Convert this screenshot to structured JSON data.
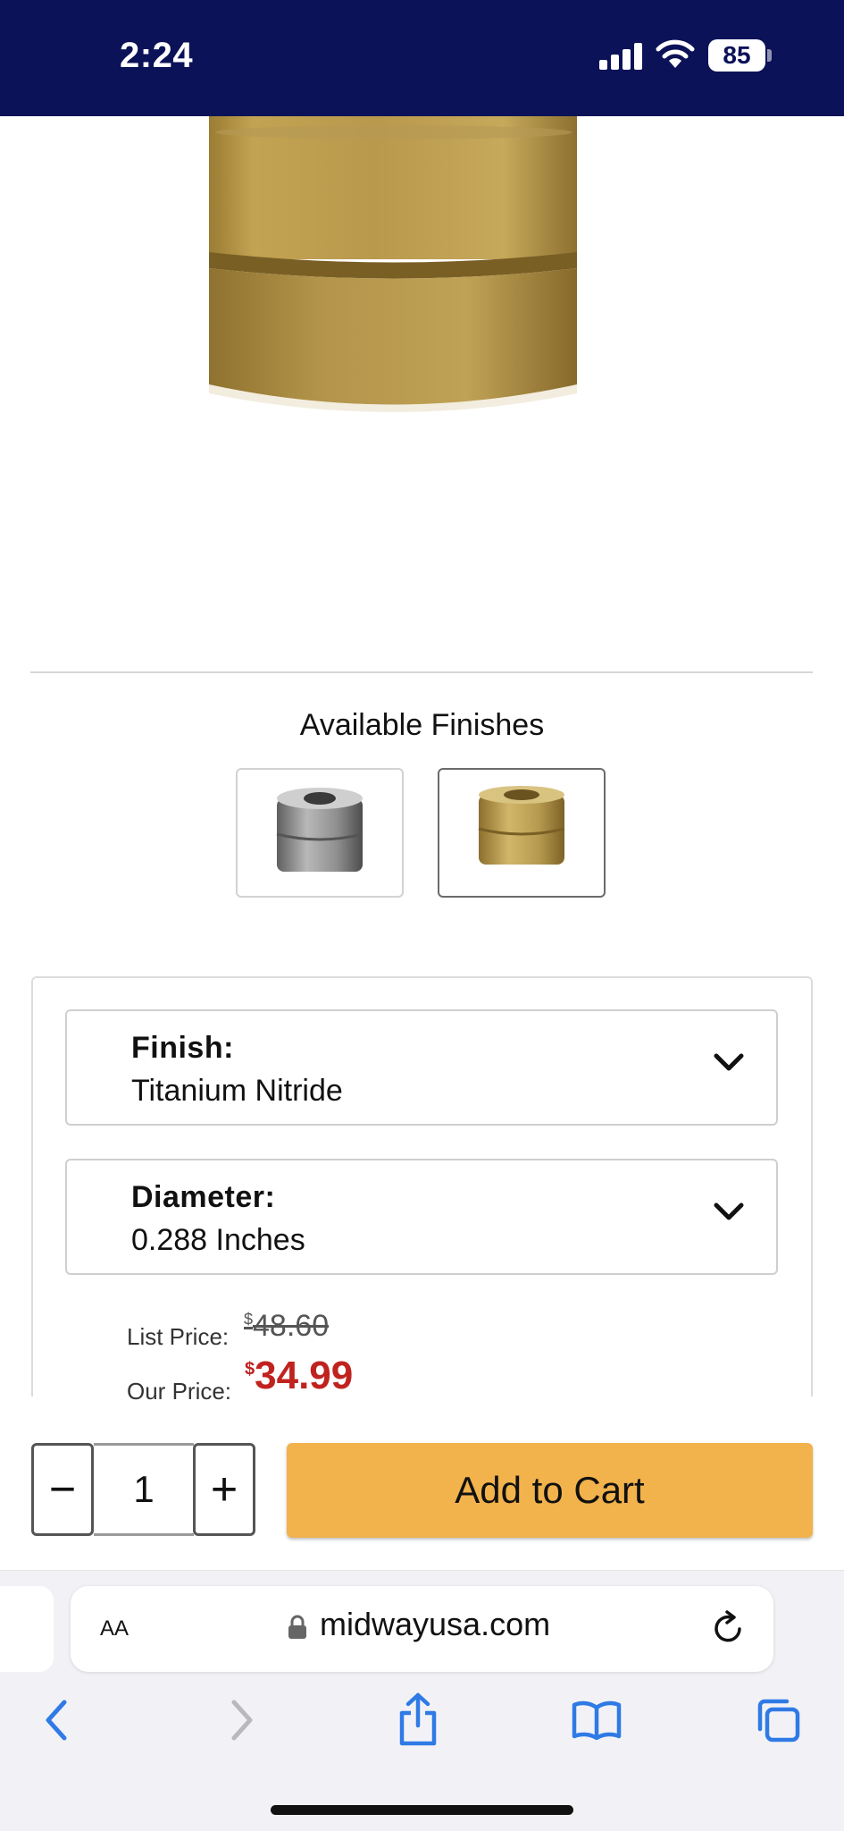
{
  "status_bar": {
    "time": "2:24",
    "battery": "85"
  },
  "product": {
    "image_alt": "Redding Neck Sizing Bushing Titanium Nitride",
    "finishes_title": "Available Finishes",
    "swatches": [
      {
        "name": "Steel",
        "color": "#9a9a9a"
      },
      {
        "name": "Titanium Nitride",
        "color": "#b89a4a"
      }
    ]
  },
  "options": {
    "finish": {
      "label": "Finish:",
      "value": "Titanium Nitride"
    },
    "diameter": {
      "label": "Diameter:",
      "value": "0.288 Inches"
    }
  },
  "pricing": {
    "list_label": "List Price:",
    "currency": "$",
    "list_price": "48.60",
    "our_label": "Our Price:",
    "our_price": "34.99",
    "price_color": "#c0231f"
  },
  "cart": {
    "decrement": "−",
    "quantity": "1",
    "increment": "+",
    "add_label": "Add to Cart",
    "button_color": "#f2b24c"
  },
  "browser": {
    "text_size_button": "AA",
    "url": "midwayusa.com",
    "accent": "#2f7ae5"
  }
}
